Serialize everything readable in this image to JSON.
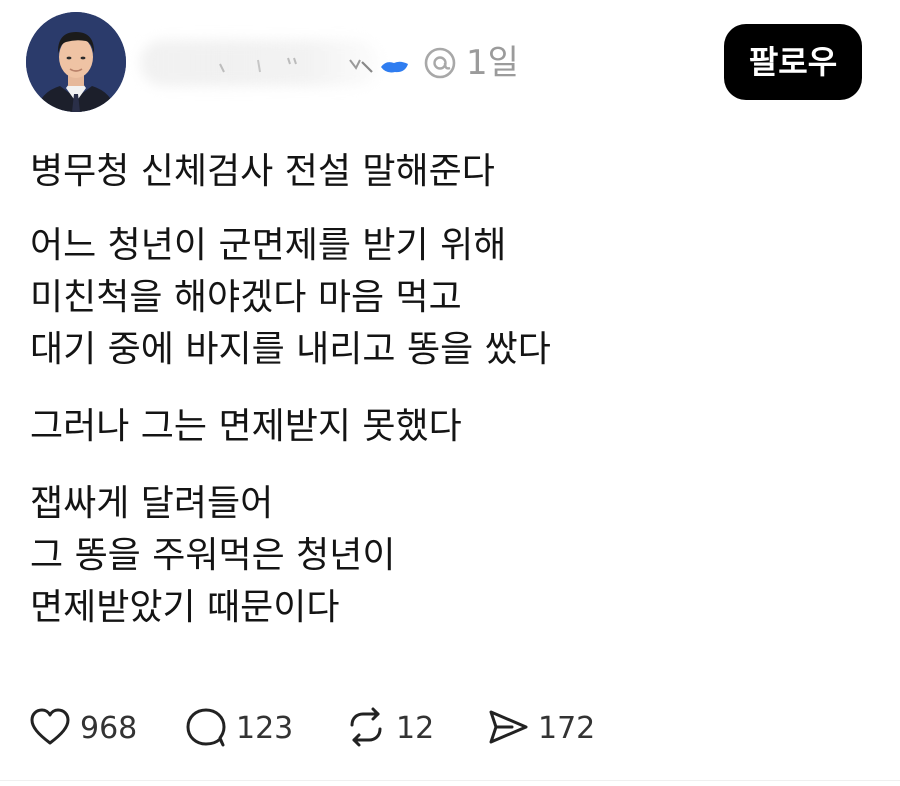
{
  "header": {
    "time_ago": "1일",
    "follow_label": "팔로우",
    "threads_icon": "threads-logo-icon",
    "avatar": "profile-photo"
  },
  "post": {
    "paragraphs": [
      [
        "병무청 신체검사 전설 말해준다"
      ],
      [
        "어느 청년이 군면제를 받기 위해",
        "미친척을 해야겠다 마음 먹고",
        "대기 중에 바지를 내리고 똥을 쌌다"
      ],
      [
        "그러나 그는 면제받지 못했다"
      ],
      [
        "잽싸게 달려들어",
        "그 똥을 주워먹은 청년이",
        "면제받았기 때문이다"
      ]
    ]
  },
  "actions": {
    "like": {
      "icon": "heart-icon",
      "count": "968"
    },
    "reply": {
      "icon": "comment-bubble-icon",
      "count": "123"
    },
    "repost": {
      "icon": "repost-icon",
      "count": "12"
    },
    "share": {
      "icon": "send-icon",
      "count": "172"
    }
  },
  "colors": {
    "follow_bg": "#000000",
    "follow_text": "#ffffff",
    "muted_text": "#9b9b9b",
    "verified_blue": "#2f7df0"
  }
}
